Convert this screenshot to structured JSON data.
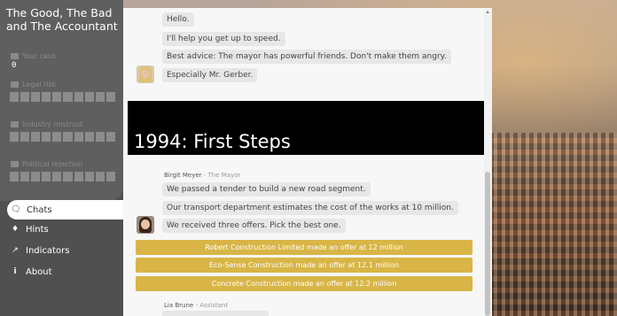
{
  "sidebar": {
    "title": "The Good, The Bad and The Accountant",
    "stats": [
      {
        "label": "Your cash",
        "icon": "cash-icon"
      },
      {
        "label": "Legal risk",
        "icon": "scale-icon"
      },
      {
        "label": "Industry mistrust",
        "icon": "factory-icon"
      },
      {
        "label": "Political rejection",
        "icon": "handshake-icon"
      }
    ],
    "cash_value": "0",
    "nav": [
      {
        "label": "Chats",
        "icon": "chat-icon",
        "active": true
      },
      {
        "label": "Hints",
        "icon": "lightbulb-icon"
      },
      {
        "label": "Indicators",
        "icon": "line-chart-icon"
      },
      {
        "label": "About",
        "icon": "info-icon"
      }
    ]
  },
  "chat": {
    "intro_messages": [
      "Hello.",
      "I'll help you get up to speed.",
      "Best advice: The mayor has powerful friends. Don't make them angry.",
      "Especially Mr. Gerber."
    ],
    "chapter_title": "1994: First Steps",
    "mayor": {
      "name": "Birgit Meyer",
      "role": "The Mayor",
      "messages": [
        "We passed a tender to build a new road segment.",
        "Our transport department estimates the cost of the works at 10 million.",
        "We received three offers. Pick the best one."
      ]
    },
    "options": [
      "Robert Construction Limited made an offer at 12 million",
      "Eco-Sense Construction made an offer at 12.1 million",
      "Concrete Construction made an offer at 12.2 million"
    ],
    "next_sender": {
      "name": "Lia Brune",
      "role": "Assistant"
    }
  },
  "colors": {
    "option_bg": "#d8b546",
    "sidebar_bg": "#505050",
    "chapter_bg": "#000000"
  }
}
